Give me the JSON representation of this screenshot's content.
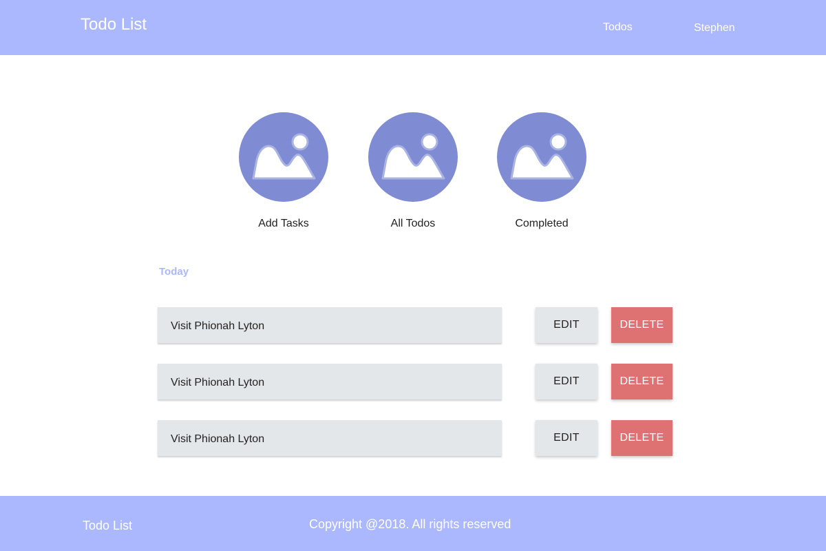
{
  "header": {
    "brand": "Todo List",
    "nav": {
      "todos": "Todos",
      "user": "Stephen"
    }
  },
  "features": [
    {
      "label": "Add Tasks",
      "icon": "image-placeholder-icon"
    },
    {
      "label": "All Todos",
      "icon": "image-placeholder-icon"
    },
    {
      "label": "Completed",
      "icon": "image-placeholder-icon"
    }
  ],
  "section": {
    "title": "Today"
  },
  "todos": [
    {
      "text": "Visit Phionah Lyton",
      "edit_label": "EDIT",
      "delete_label": "DELETE"
    },
    {
      "text": "Visit Phionah Lyton",
      "edit_label": "EDIT",
      "delete_label": "DELETE"
    },
    {
      "text": "Visit Phionah Lyton",
      "edit_label": "EDIT",
      "delete_label": "DELETE"
    }
  ],
  "footer": {
    "brand": "Todo List",
    "copyright": "Copyright @2018. All rights reserved"
  },
  "colors": {
    "primary": "#abb8fd",
    "circle": "#7f8bd3",
    "delete": "#de7171",
    "neutral": "#e4e7ea"
  }
}
